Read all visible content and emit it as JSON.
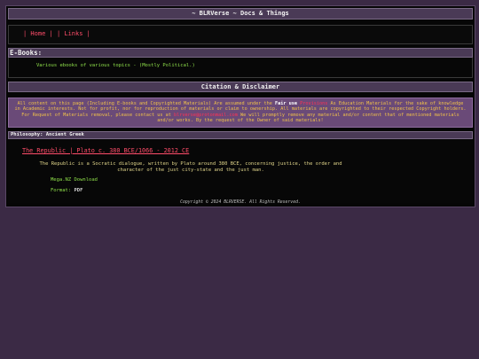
{
  "header": {
    "title": "~ BLRVerse ~ Docs & Things"
  },
  "nav": {
    "home_label": "| Home |",
    "links_label": "| Links |"
  },
  "ebooks": {
    "heading": "E-Books:",
    "description": "Various ebooks of various topics - (Mostly Political.)"
  },
  "citation": {
    "heading": "Citation & Disclaimer",
    "text_1": "All content on this page (Including E-books and Copyrighted Materials) Are assumed under the ",
    "fair_use": "Fair use",
    "link_text": "Provisions",
    "text_2": " As Education Materials for the sake of knowledge in Academic interests. Not for profit, nor for reproduction of materials or claim to ownership. All materials are copyrighted to their respected Copyright holders. For Request of Materials removal, please contact us at ",
    "email": "blrverse@protonmail.com",
    "text_3": " We will promptly remove any material and/or content that of mentioned materials and/or works. By the request of the Owner of said materials!"
  },
  "philosophy": {
    "heading": "Philosophy: Ancient Greek",
    "book": {
      "title": "The Republic | Plato c. 380 BCE/1066 - 2012 CE",
      "description": "The Republic is a Socratic dialogue, written by Plato around 380 BCE, concerning justice, the order and character of the just city-state and the just man.",
      "download_label": "Mega.NZ Download",
      "format_label": "Format:",
      "format_value": "PDF"
    }
  },
  "footer": {
    "copyright": "Copyright © 2024 BLRVERSE. All Rights Reserved."
  }
}
